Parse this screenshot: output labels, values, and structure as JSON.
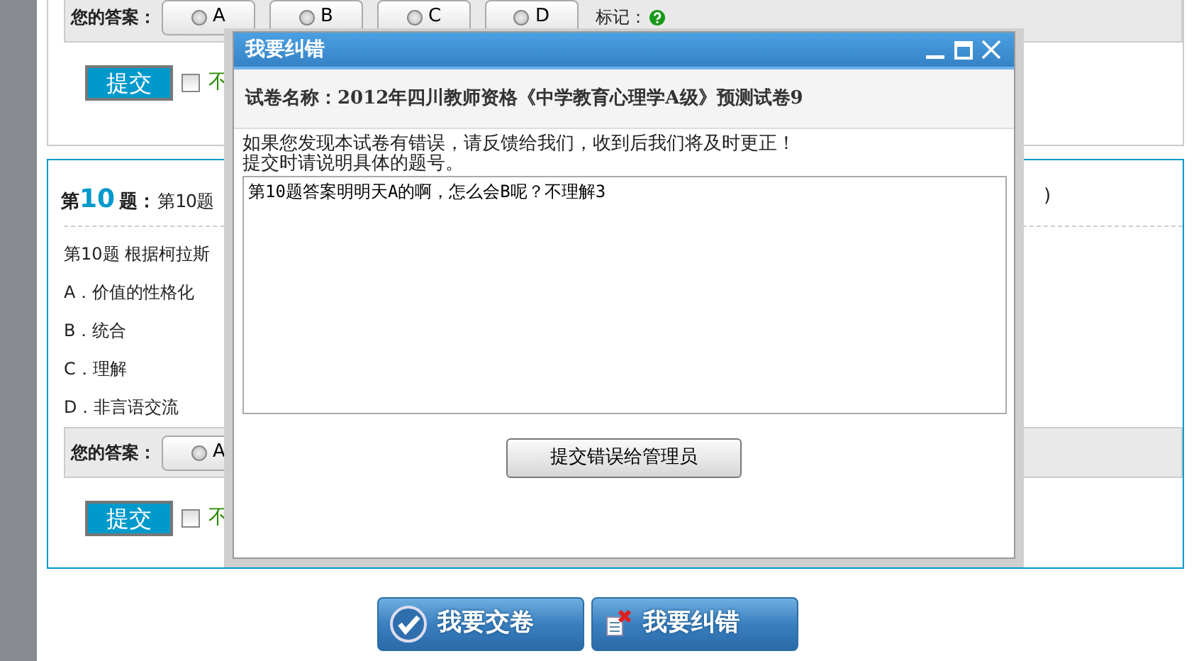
{
  "previous_question": {
    "answer_label": "您的答案：",
    "options": [
      {
        "label": "A",
        "selected": false
      },
      {
        "label": "B",
        "selected": false
      },
      {
        "label": "C",
        "selected": false
      },
      {
        "label": "D",
        "selected": false
      }
    ],
    "mark_label": "标记：",
    "submit": "提交",
    "unsure": {
      "label": "不",
      "checked": false
    }
  },
  "question": {
    "prefix": "第",
    "number": "10",
    "suffix": "题：",
    "title_text": "第10题",
    "paren": ")",
    "stem": "第10题 根据柯拉斯",
    "options": [
      "A．价值的性格化",
      "B．统合",
      "C．理解",
      "D．非言语交流"
    ],
    "answer_label": "您的答案：",
    "answer_options": [
      {
        "label": "A",
        "selected": false
      }
    ],
    "submit": "提交",
    "unsure": {
      "label": "不",
      "checked": false
    }
  },
  "footer_buttons": [
    {
      "label": "我要交卷",
      "kind": "submit"
    },
    {
      "label": "我要纠错",
      "kind": "report"
    }
  ],
  "dialog": {
    "title": "我要纠错",
    "paper_label": "试卷名称：",
    "paper_name": "2012年四川教师资格《中学教育心理学A级》预测试卷9",
    "message": [
      "如果您发现本试卷有错误，请反馈给我们，收到后我们将及时更正！",
      "提交时请说明具体的题号。"
    ],
    "textarea": {
      "value": "第10题答案明明天A的啊，怎么会B呢？不理解3"
    },
    "button": "提交错误给管理员"
  }
}
